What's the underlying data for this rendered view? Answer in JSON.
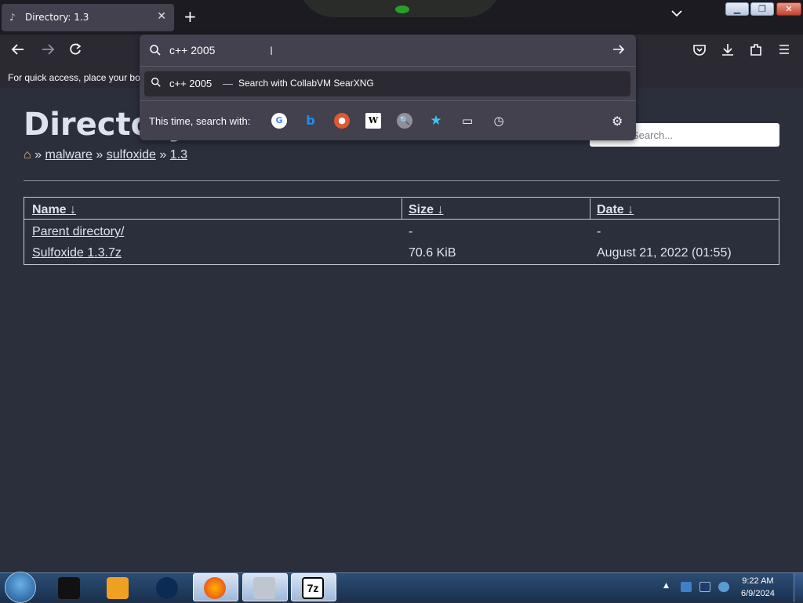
{
  "browser": {
    "tab": {
      "title": "Directory: 1.3",
      "close": "✕"
    },
    "new_tab": "+",
    "url_text": "c++ 2005",
    "bookmarks_hint": "For quick access, place your boo"
  },
  "url_dropdown": {
    "suggestion_query": "c++ 2005",
    "suggestion_dash": "—",
    "suggestion_engine": "Search with CollabVM SearXNG",
    "one_off_label": "This time, search with:",
    "engines": [
      "Google",
      "Bing",
      "DuckDuckGo",
      "Wikipedia",
      "CollabVM SearXNG",
      "Bookmarks",
      "Tabs",
      "History"
    ]
  },
  "page": {
    "title": "Directory",
    "breadcrumb": {
      "home_icon": "home-icon",
      "sep": "»",
      "items": [
        "malware",
        "sulfoxide",
        "1.3"
      ]
    },
    "search_placeholder": "Search...",
    "table": {
      "headers": [
        "Name ↓",
        "Size ↓",
        "Date ↓"
      ],
      "rows": [
        {
          "name": "Parent directory/",
          "size": "-",
          "date": "-"
        },
        {
          "name": "Sulfoxide 1.3.7z",
          "size": "70.6 KiB",
          "date": "August 21, 2022 (01:55)"
        }
      ]
    }
  },
  "taskbar": {
    "clock_time": "9:22 AM",
    "clock_date": "6/9/2024",
    "pinned": [
      "media-icon",
      "player-icon",
      "globe-icon",
      "firefox-icon",
      "control-panel-icon",
      "7zip-icon"
    ],
    "seven_zip_label": "7z"
  },
  "colors": {
    "page_bg": "#2b2f3c",
    "panel_bg": "#42414d",
    "text": "#dde3ee"
  }
}
